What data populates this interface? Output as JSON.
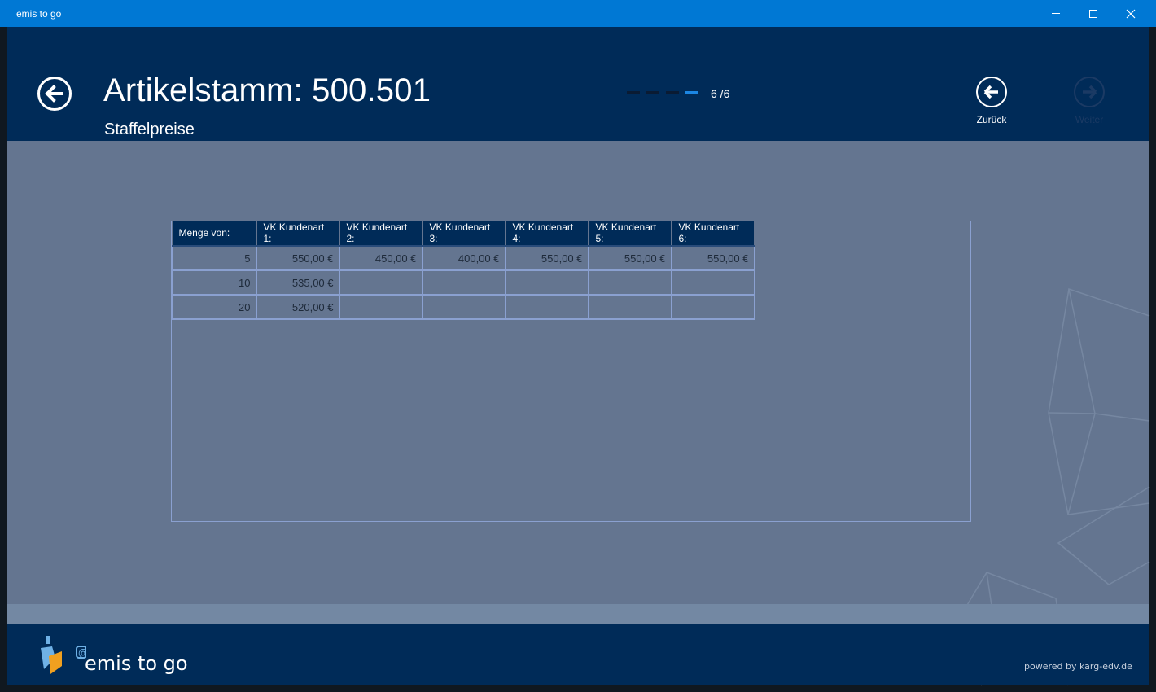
{
  "window": {
    "title": "emis to go"
  },
  "header": {
    "title": "Artikelstamm: 500.501",
    "subtitle": "Staffelpreise",
    "pager": {
      "current": 6,
      "total": 6,
      "counter_text": "6 /6"
    },
    "prev_label": "Zurück",
    "next_label": "Weiter"
  },
  "table": {
    "columns": [
      "Menge von:",
      "VK Kundenart 1:",
      "VK Kundenart 2:",
      "VK Kundenart 3:",
      "VK Kundenart 4:",
      "VK Kundenart 5:",
      "VK Kundenart 6:"
    ],
    "rows": [
      [
        "5",
        "550,00 €",
        "450,00 €",
        "400,00 €",
        "550,00 €",
        "550,00 €",
        "550,00 €"
      ],
      [
        "10",
        "535,00 €",
        "",
        "",
        "",
        "",
        ""
      ],
      [
        "20",
        "520,00 €",
        "",
        "",
        "",
        "",
        ""
      ]
    ]
  },
  "footer": {
    "brand": "emis to go",
    "powered_by": "powered by karg-edv.de"
  },
  "icons": {
    "back": "arrow-left-circle-icon",
    "prev": "arrow-left-circle-icon",
    "next": "arrow-right-circle-icon",
    "logo": "emis-bottle-logo"
  },
  "colors": {
    "titlebar": "#0078d4",
    "header": "#002b58",
    "content": "#647590",
    "pager_active": "#1c86e2"
  }
}
